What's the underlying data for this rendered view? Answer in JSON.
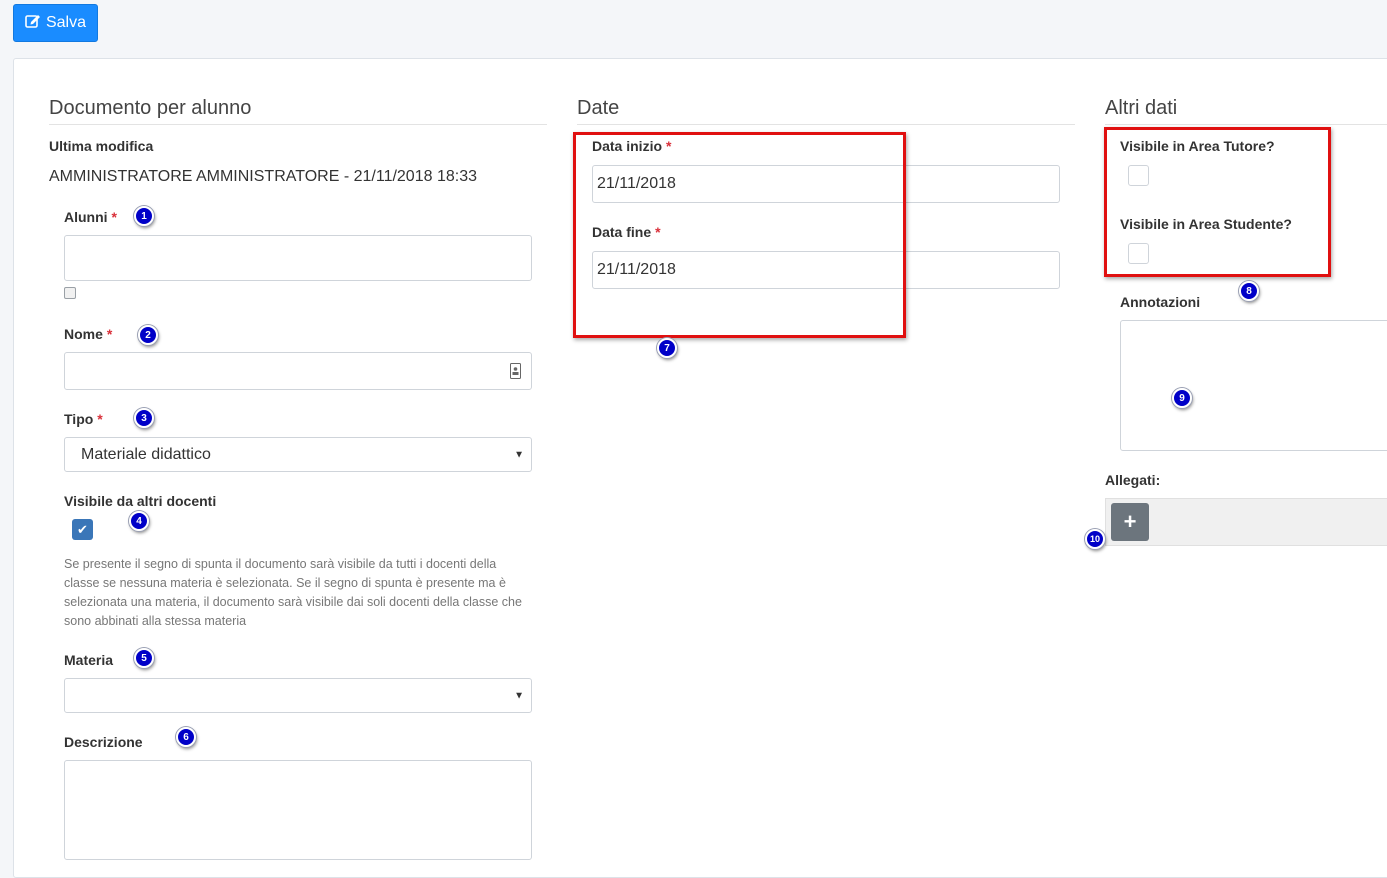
{
  "toolbar": {
    "save_label": "Salva",
    "save_icon": "edit-icon"
  },
  "sections": {
    "documento": {
      "title": "Documento per alunno"
    },
    "date": {
      "title": "Date"
    },
    "altri": {
      "title": "Altri dati"
    }
  },
  "documento": {
    "ultima_modifica_label": "Ultima modifica",
    "ultima_modifica_value": "AMMINISTRATORE AMMINISTRATORE - 21/11/2018 18:33",
    "alunni_label": "Alunni",
    "nome_label": "Nome",
    "tipo_label": "Tipo",
    "tipo_value": "Materiale didattico",
    "visibile_label": "Visibile da altri docenti",
    "visibile_checked": true,
    "help_text": "Se presente il segno di spunta il documento sarà visibile da tutti i docenti della classe se nessuna materia è selezionata. Se il segno di spunta è presente ma è selezionata una materia, il documento sarà visibile dai soli docenti della classe che sono abbinati alla stessa materia",
    "materia_label": "Materia",
    "materia_value": "",
    "descrizione_label": "Descrizione",
    "required_mark": "*"
  },
  "date": {
    "inizio_label": "Data inizio",
    "inizio_value": "21/11/2018",
    "fine_label": "Data fine",
    "fine_value": "21/11/2018"
  },
  "altri": {
    "tutore_label": "Visibile in Area Tutore?",
    "studente_label": "Visibile in Area Studente?",
    "annotazioni_label": "Annotazioni",
    "allegati_label": "Allegati:",
    "add_label": "+"
  },
  "badges": [
    "1",
    "2",
    "3",
    "4",
    "5",
    "6",
    "7",
    "8",
    "9",
    "10"
  ],
  "colors": {
    "primary": "#1a8cff",
    "annotation_red": "#e01010",
    "badge_blue": "#0000c8",
    "checkbox_blue": "#3a76b8"
  }
}
